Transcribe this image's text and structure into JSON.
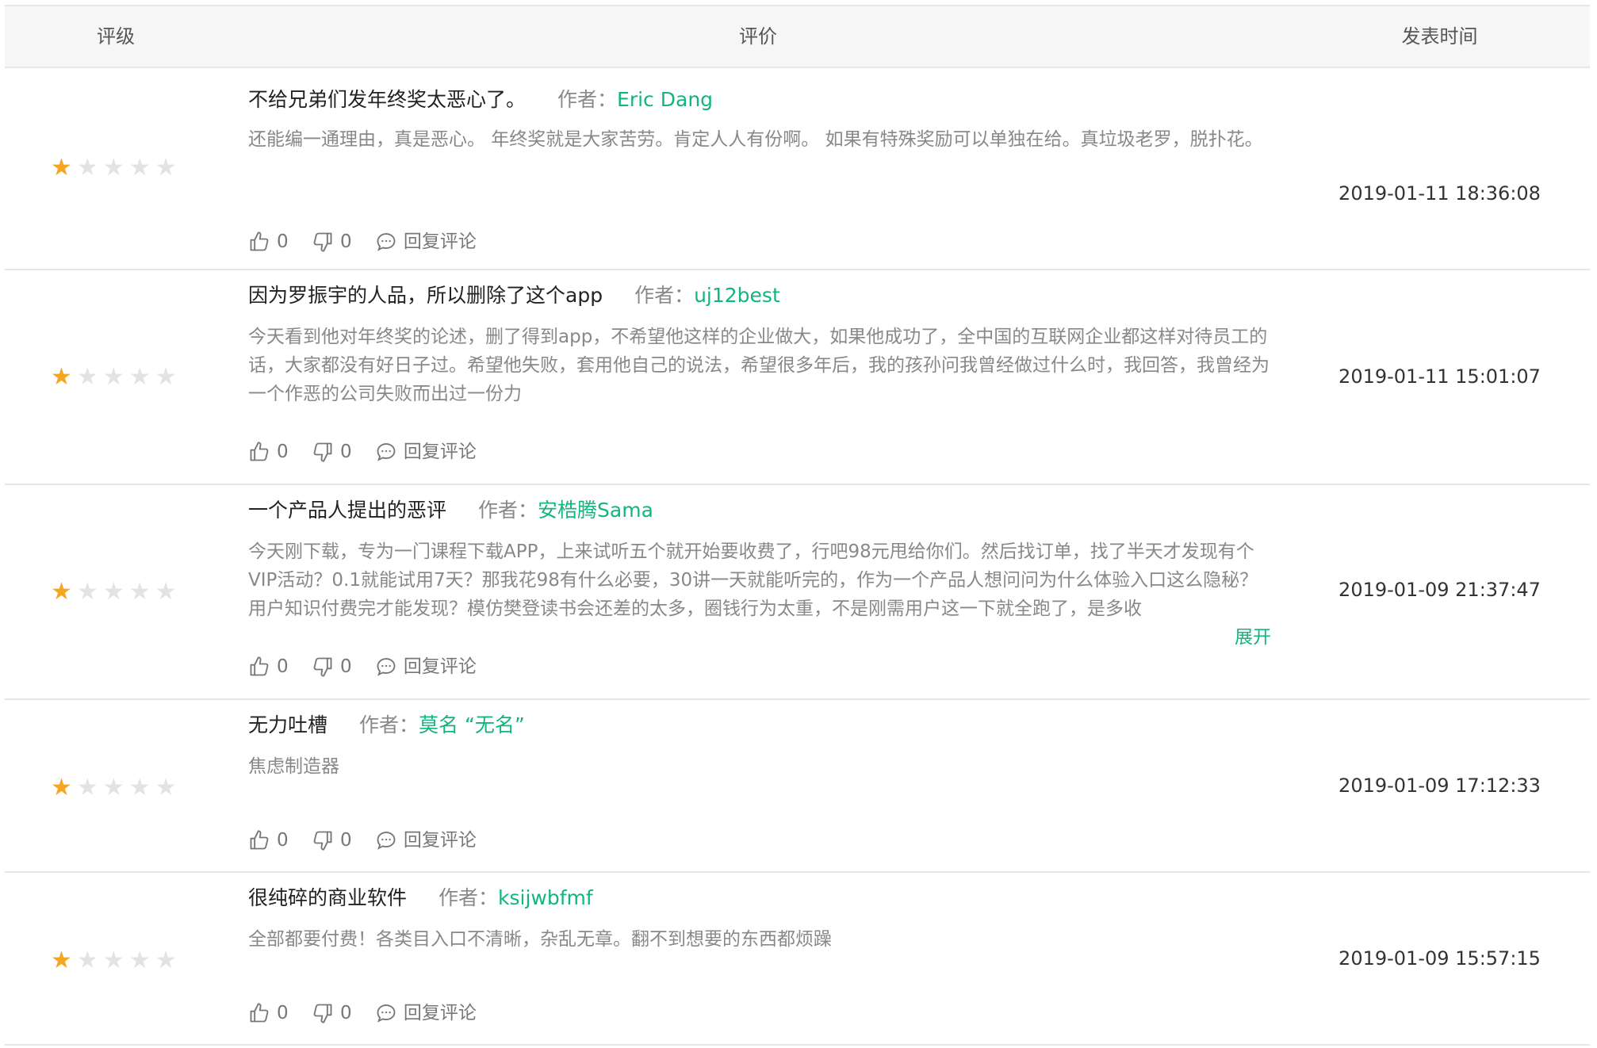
{
  "header": {
    "rating": "评级",
    "review": "评价",
    "time": "发表时间"
  },
  "author_label": "作者：",
  "reviews": [
    {
      "rating": 1,
      "title": "不给兄弟们发年终奖太恶心了。",
      "author": "Eric Dang",
      "body": "还能编一通理由，真是恶心。 年终奖就是大家苦劳。肯定人人有份啊。 如果有特殊奖励可以单独在给。真垃圾老罗，脱扑花。",
      "likes": "0",
      "dislikes": "0",
      "reply": "回复评论",
      "time": "2019-01-11 18:36:08"
    },
    {
      "rating": 1,
      "title": "因为罗振宇的人品，所以删除了这个app",
      "author": "uj12best",
      "body": "今天看到他对年终奖的论述，删了得到app，不希望他这样的企业做大，如果他成功了，全中国的互联网企业都这样对待员工的话，大家都没有好日子过。希望他失败，套用他自己的说法，希望很多年后，我的孩孙问我曾经做过什么时，我回答，我曾经为一个作恶的公司失败而出过一份力",
      "likes": "0",
      "dislikes": "0",
      "reply": "回复评论",
      "time": "2019-01-11 15:01:07"
    },
    {
      "rating": 1,
      "title": "一个产品人提出的恶评",
      "author": "安梏腾Sama",
      "body": "今天刚下载，专为一门课程下载APP，上来试听五个就开始要收费了，行吧98元甩给你们。然后找订单，找了半天才发现有个VIP活动？0.1就能试用7天？那我花98有什么必要，30讲一天就能听完的，作为一个产品人想问问为什么体验入口这么隐秘？用户知识付费完才能发现？模仿樊登读书会还差的太多，圈钱行为太重，不是刚需用户这一下就全跑了，是多收",
      "expand": "展开",
      "likes": "0",
      "dislikes": "0",
      "reply": "回复评论",
      "time": "2019-01-09 21:37:47"
    },
    {
      "rating": 1,
      "title": "无力吐槽",
      "author": "莫名 “无名”",
      "body": "焦虑制造器",
      "likes": "0",
      "dislikes": "0",
      "reply": "回复评论",
      "time": "2019-01-09 17:12:33"
    },
    {
      "rating": 1,
      "title": "很纯碎的商业软件",
      "author": "ksijwbfmf",
      "body": "全部都要付费！各类目入口不清晰，杂乱无章。翻不到想要的东西都烦躁",
      "likes": "0",
      "dislikes": "0",
      "reply": "回复评论",
      "time": "2019-01-09 15:57:15"
    }
  ],
  "colors": {
    "accent": "#13b57e",
    "star": "#f5a623",
    "star_off": "#e3e3e3"
  },
  "icons": [
    "thumbs-up-icon",
    "thumbs-down-icon",
    "comment-icon",
    "star-icon"
  ]
}
